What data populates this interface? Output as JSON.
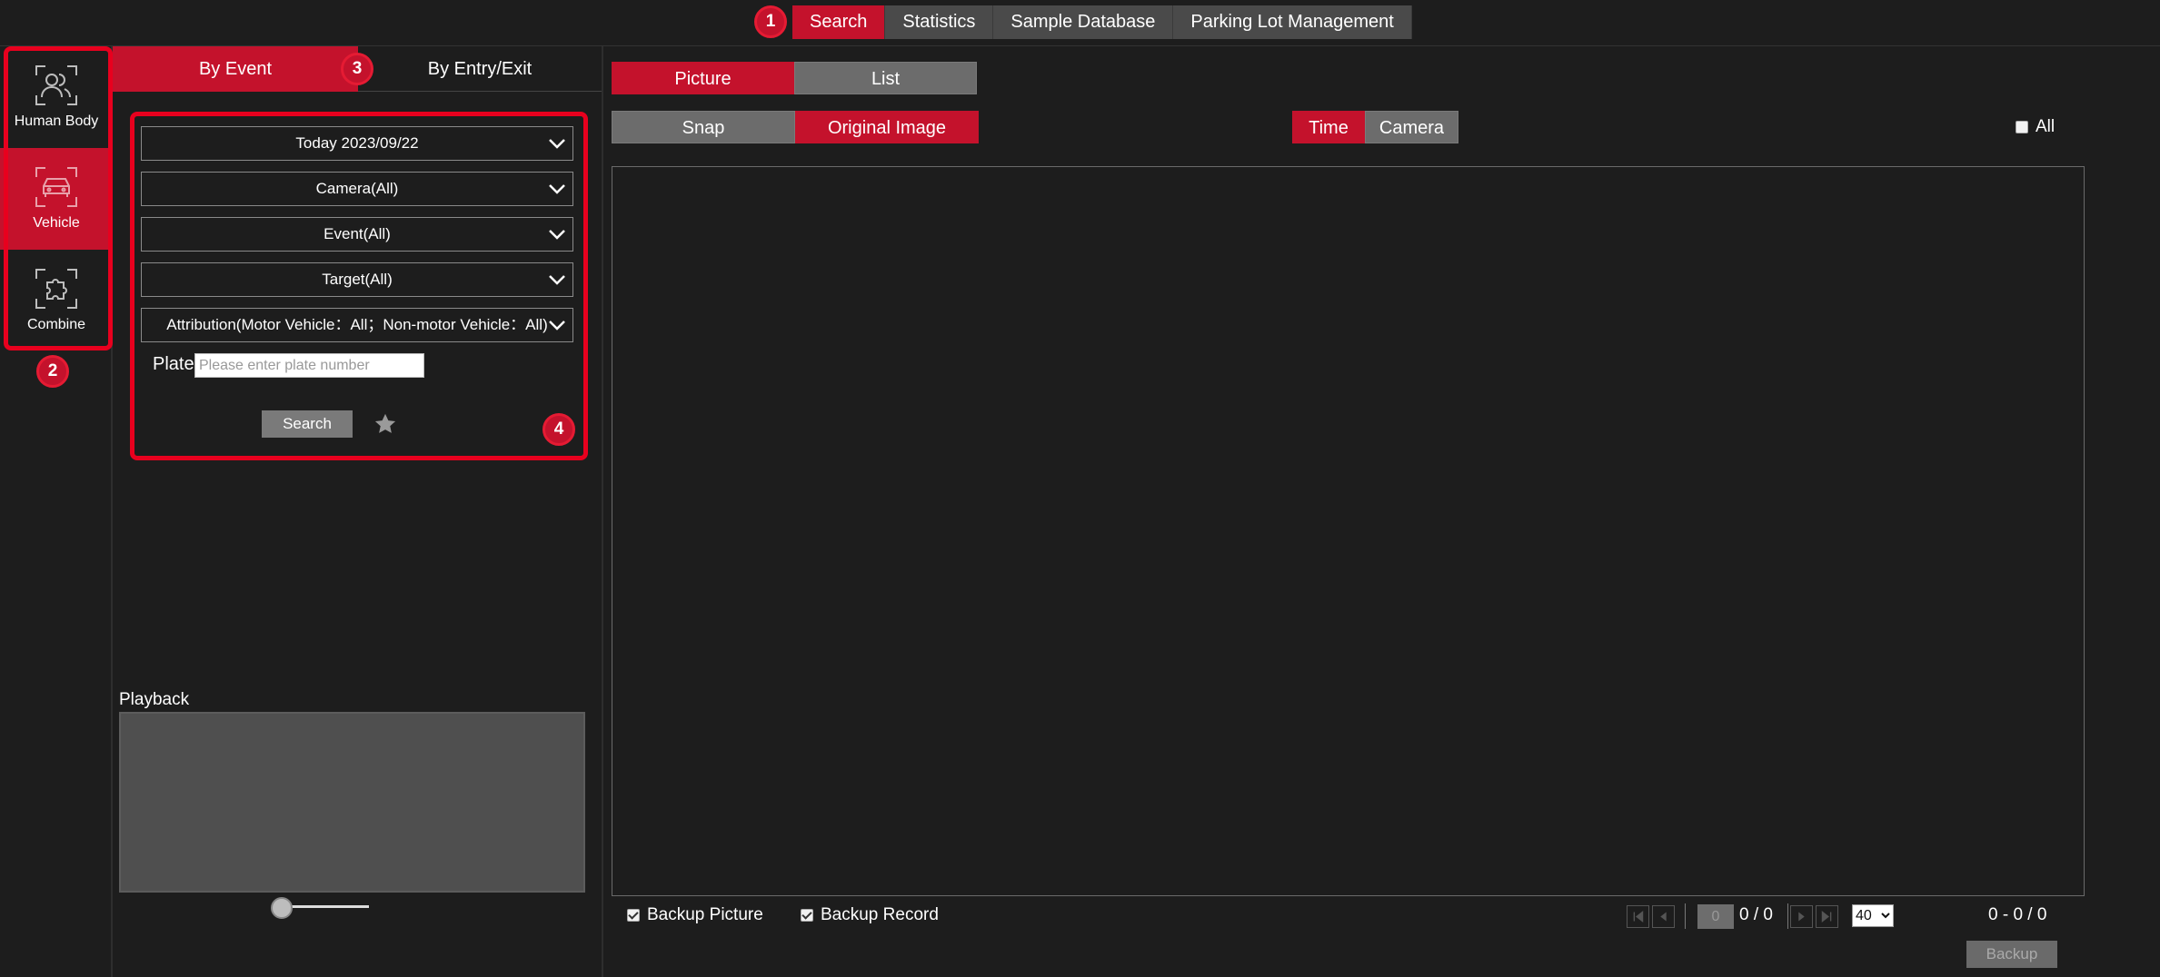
{
  "top_nav": {
    "tabs": [
      {
        "label": "Search",
        "active": true
      },
      {
        "label": "Statistics",
        "active": false
      },
      {
        "label": "Sample Database",
        "active": false
      },
      {
        "label": "Parking Lot Management",
        "active": false
      }
    ]
  },
  "annotations": {
    "b1": "1",
    "b2": "2",
    "b3": "3",
    "b4": "4"
  },
  "sidebar": {
    "items": [
      {
        "label": "Human Body",
        "icon": "human-body-icon",
        "active": false
      },
      {
        "label": "Vehicle",
        "icon": "vehicle-icon",
        "active": true
      },
      {
        "label": "Combine",
        "icon": "combine-icon",
        "active": false
      }
    ]
  },
  "filter_panel": {
    "tabs": [
      {
        "label": "By Event",
        "active": true
      },
      {
        "label": "By Entry/Exit",
        "active": false
      }
    ],
    "dropdowns": {
      "date": "Today 2023/09/22",
      "camera": "Camera(All)",
      "event": "Event(All)",
      "target": "Target(All)",
      "attribution": "Attribution(Motor Vehicle：All；Non-motor Vehicle：All)"
    },
    "plate_label": "Plate",
    "plate_placeholder": "Please enter plate number",
    "search_label": "Search"
  },
  "playback": {
    "label": "Playback"
  },
  "main": {
    "view_tabs": [
      {
        "label": "Picture",
        "active": true
      },
      {
        "label": "List",
        "active": false
      }
    ],
    "image_tabs": [
      {
        "label": "Snap",
        "active": false
      },
      {
        "label": "Original Image",
        "active": true
      }
    ],
    "sort_tabs": [
      {
        "label": "Time",
        "active": true
      },
      {
        "label": "Camera",
        "active": false
      }
    ],
    "all_label": "All",
    "backup_picture": "Backup Picture",
    "backup_record": "Backup Record",
    "pager": {
      "page": "0",
      "page_total": "0 / 0",
      "page_size": "40",
      "range": "0 - 0 / 0"
    },
    "backup_label": "Backup"
  },
  "colors": {
    "accent": "#c4122c",
    "annotation_red": "#e8001e",
    "background": "#1d1d1d"
  }
}
